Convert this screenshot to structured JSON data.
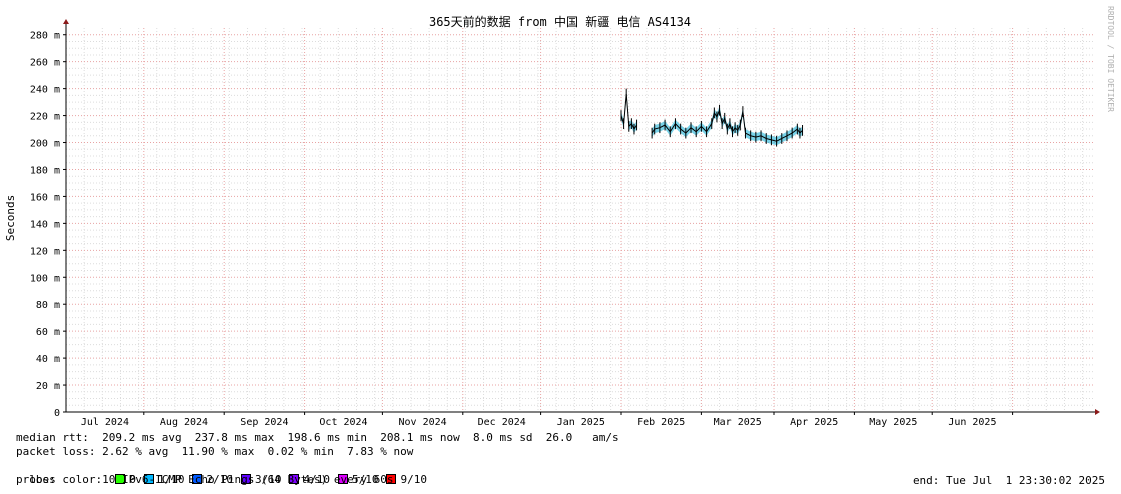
{
  "chart_data": {
    "type": "line",
    "title": "365天前的数据 from 中国 新疆 电信 AS4134",
    "ylabel": "Seconds",
    "watermark": "RRDTOOL / TOBI OETIKER",
    "ylim": [
      0,
      285
    ],
    "yticks": [
      {
        "value": 0,
        "label": "0"
      },
      {
        "value": 20,
        "label": "20 m"
      },
      {
        "value": 40,
        "label": "40 m"
      },
      {
        "value": 60,
        "label": "60 m"
      },
      {
        "value": 80,
        "label": "80 m"
      },
      {
        "value": 100,
        "label": "100 m"
      },
      {
        "value": 120,
        "label": "120 m"
      },
      {
        "value": 140,
        "label": "140 m"
      },
      {
        "value": 160,
        "label": "160 m"
      },
      {
        "value": 180,
        "label": "180 m"
      },
      {
        "value": 200,
        "label": "200 m"
      },
      {
        "value": 220,
        "label": "220 m"
      },
      {
        "value": 240,
        "label": "240 m"
      },
      {
        "value": 260,
        "label": "260 m"
      },
      {
        "value": 280,
        "label": "280 m"
      }
    ],
    "x_range": [
      "2024-06-01",
      "2025-07-02"
    ],
    "xticks": [
      {
        "date": "2024-07-01",
        "label": "Jul 2024"
      },
      {
        "date": "2024-08-01",
        "label": "Aug 2024"
      },
      {
        "date": "2024-09-01",
        "label": "Sep 2024"
      },
      {
        "date": "2024-10-01",
        "label": "Oct 2024"
      },
      {
        "date": "2024-11-01",
        "label": "Nov 2024"
      },
      {
        "date": "2024-12-01",
        "label": "Dec 2024"
      },
      {
        "date": "2025-01-01",
        "label": "Jan 2025"
      },
      {
        "date": "2025-02-01",
        "label": "Feb 2025"
      },
      {
        "date": "2025-03-01",
        "label": "Mar 2025"
      },
      {
        "date": "2025-04-01",
        "label": "Apr 2025"
      },
      {
        "date": "2025-05-01",
        "label": "May 2025"
      },
      {
        "date": "2025-06-01",
        "label": "Jun 2025"
      }
    ],
    "series": [
      {
        "name": "median rtt",
        "color": "#000000",
        "band_color": "#1fb4d8",
        "points": [
          {
            "x": "2025-01-01",
            "y": 220
          },
          {
            "x": "2025-01-02",
            "y": 214
          },
          {
            "x": "2025-01-03",
            "y": 236
          },
          {
            "x": "2025-01-04",
            "y": 212
          },
          {
            "x": "2025-01-05",
            "y": 214
          },
          {
            "x": "2025-01-06",
            "y": 210
          },
          {
            "x": "2025-01-07",
            "y": 213
          },
          {
            "x": "2025-01-13",
            "y": 207
          },
          {
            "x": "2025-01-14",
            "y": 210
          },
          {
            "x": "2025-01-16",
            "y": 211
          },
          {
            "x": "2025-01-18",
            "y": 213
          },
          {
            "x": "2025-01-20",
            "y": 208
          },
          {
            "x": "2025-01-22",
            "y": 214
          },
          {
            "x": "2025-01-24",
            "y": 210
          },
          {
            "x": "2025-01-26",
            "y": 207
          },
          {
            "x": "2025-01-28",
            "y": 211
          },
          {
            "x": "2025-01-30",
            "y": 208
          },
          {
            "x": "2025-02-01",
            "y": 212
          },
          {
            "x": "2025-02-03",
            "y": 208
          },
          {
            "x": "2025-02-05",
            "y": 214
          },
          {
            "x": "2025-02-06",
            "y": 222
          },
          {
            "x": "2025-02-07",
            "y": 219
          },
          {
            "x": "2025-02-08",
            "y": 224
          },
          {
            "x": "2025-02-09",
            "y": 214
          },
          {
            "x": "2025-02-10",
            "y": 218
          },
          {
            "x": "2025-02-11",
            "y": 210
          },
          {
            "x": "2025-02-12",
            "y": 214
          },
          {
            "x": "2025-02-13",
            "y": 208
          },
          {
            "x": "2025-02-14",
            "y": 211
          },
          {
            "x": "2025-02-15",
            "y": 209
          },
          {
            "x": "2025-02-16",
            "y": 213
          },
          {
            "x": "2025-02-17",
            "y": 223
          },
          {
            "x": "2025-02-18",
            "y": 207
          },
          {
            "x": "2025-02-20",
            "y": 205
          },
          {
            "x": "2025-02-22",
            "y": 204
          },
          {
            "x": "2025-02-24",
            "y": 205
          },
          {
            "x": "2025-02-26",
            "y": 203
          },
          {
            "x": "2025-02-28",
            "y": 202
          },
          {
            "x": "2025-03-02",
            "y": 201
          },
          {
            "x": "2025-03-04",
            "y": 203
          },
          {
            "x": "2025-03-06",
            "y": 205
          },
          {
            "x": "2025-03-08",
            "y": 207
          },
          {
            "x": "2025-03-10",
            "y": 210
          },
          {
            "x": "2025-03-11",
            "y": 207
          },
          {
            "x": "2025-03-12",
            "y": 209
          }
        ]
      }
    ],
    "grid": true,
    "legend_placement": "bottom"
  },
  "legend": {
    "median_rtt_line": "median rtt:  209.2 ms avg  237.8 ms max  198.6 ms min  208.1 ms now  8.0 ms sd  26.0   am/s",
    "packet_loss_line": "packet loss: 2.62 % avg  11.90 % max  0.02 % min  7.83 % now",
    "loss_color_label": "loss color:",
    "loss_colors": [
      {
        "label": "0",
        "color": "#26ff00"
      },
      {
        "label": "1/10",
        "color": "#00b8ff"
      },
      {
        "label": "2/10",
        "color": "#0059ff"
      },
      {
        "label": "3/10",
        "color": "#5e00ff"
      },
      {
        "label": "4/10",
        "color": "#7e00ff"
      },
      {
        "label": "5/10",
        "color": "#dd00ff"
      },
      {
        "label": "9/10",
        "color": "#ff0000"
      }
    ],
    "probe_line": "probe:       10 IPv6-ICMP Echo Pings (64 Bytes) every 60s",
    "end_line": "end: Tue Jul  1 23:30:02 2025"
  }
}
